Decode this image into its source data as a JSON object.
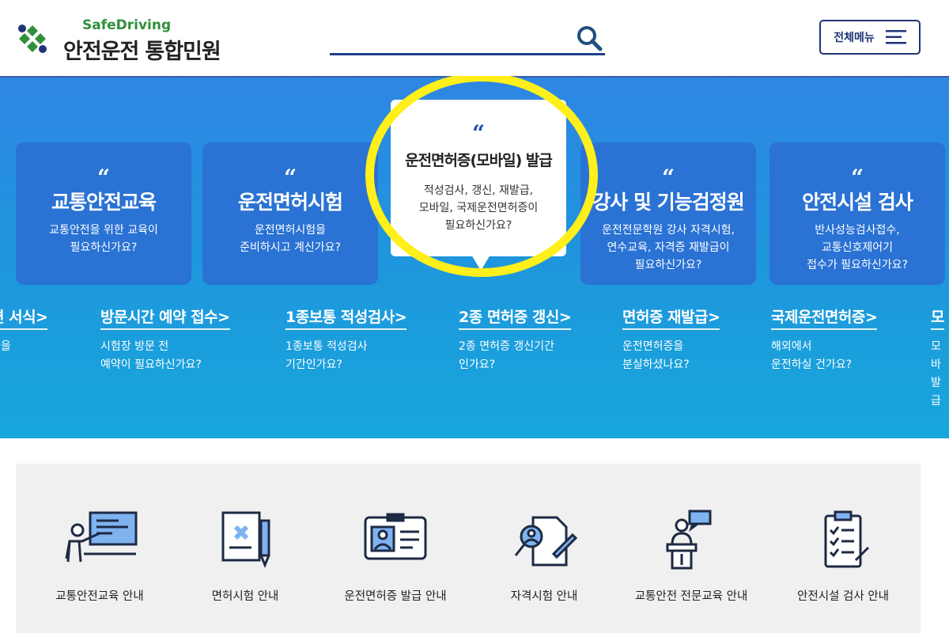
{
  "header": {
    "logo_sub": "SafeDriving",
    "logo_title_main": "안전운전",
    "logo_title_rest": "통합민원",
    "search_placeholder": "",
    "menu_label": "전체메뉴"
  },
  "colors": {
    "brand_blue": "#1f3475",
    "hero_blue": "#2a72d4",
    "highlight_yellow": "#ffef1a",
    "logo_green": "#2f8f3a"
  },
  "cards": [
    {
      "title": "교통안전교육",
      "desc": "교통안전을 위한 교육이\n필요하신가요?"
    },
    {
      "title": "운전면허시험",
      "desc": "운전면허시험을\n준비하시고 계신가요?"
    },
    {
      "title": "강사 및 기능검정원",
      "desc": "운전전문학원 강사 자격시험,\n연수교육, 자격증 재발급이\n필요하신가요?"
    },
    {
      "title": "안전시설 검사",
      "desc": "반사성능검사접수,\n교통신호제어기\n접수가 필요하신가요?"
    }
  ],
  "popup": {
    "quote": "“",
    "title": "운전면허증(모바일) 발급",
    "desc": "적성검사, 갱신, 재발급,\n모바일, 국제운전면허증이\n필요하신가요?"
  },
  "quick_links": [
    {
      "title": "련 서식>",
      "desc": "식을"
    },
    {
      "title": "방문시간 예약 접수>",
      "desc": "시험장 방문 전\n예약이 필요하신가요?"
    },
    {
      "title": "1종보통 적성검사>",
      "desc": "1종보통 적성검사\n기간인가요?"
    },
    {
      "title": "2종 면허증 갱신>",
      "desc": "2종 면허증 갱신기간\n인가요?"
    },
    {
      "title": "면허증 재발급>",
      "desc": "운전면허증을\n분실하셨나요?"
    },
    {
      "title": "국제운전면허증>",
      "desc": "해외에서\n운전하실 건가요?"
    },
    {
      "title": "모",
      "desc": "모바\n발급"
    }
  ],
  "services": [
    {
      "label": "교통안전교육 안내",
      "icon": "presentation-icon"
    },
    {
      "label": "면허시험 안내",
      "icon": "exam-document-icon"
    },
    {
      "label": "운전면허증 발급 안내",
      "icon": "license-card-icon"
    },
    {
      "label": "자격시험 안내",
      "icon": "qualification-search-icon"
    },
    {
      "label": "교통안전 전문교육 안내",
      "icon": "lecturer-podium-icon"
    },
    {
      "label": "안전시설 검사 안내",
      "icon": "checklist-icon"
    }
  ]
}
